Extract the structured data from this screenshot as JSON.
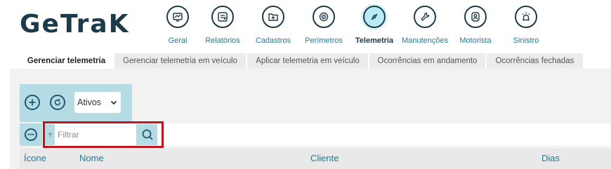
{
  "logo": {
    "text": "GeTraK"
  },
  "nav": [
    {
      "label": "Geral",
      "icon": "chart-monitor-icon",
      "active": false
    },
    {
      "label": "Relatórios",
      "icon": "report-icon",
      "active": false
    },
    {
      "label": "Cadastros",
      "icon": "folder-plus-icon",
      "active": false
    },
    {
      "label": "Perímetros",
      "icon": "geofence-icon",
      "active": false
    },
    {
      "label": "Telemetria",
      "icon": "compass-icon",
      "active": true
    },
    {
      "label": "Manutenções",
      "icon": "wrench-icon",
      "active": false
    },
    {
      "label": "Motorista",
      "icon": "driver-icon",
      "active": false
    },
    {
      "label": "Sinistro",
      "icon": "alarm-icon",
      "active": false
    }
  ],
  "tabs": [
    {
      "label": "Gerenciar telemetria",
      "active": true
    },
    {
      "label": "Gerenciar telemetria em veículo",
      "active": false
    },
    {
      "label": "Aplicar telemetria em veículo",
      "active": false
    },
    {
      "label": "Ocorrências em andamento",
      "active": false
    },
    {
      "label": "Ocorrências fechadas",
      "active": false
    }
  ],
  "toolbar": {
    "add_icon": "plus-circle-icon",
    "refresh_icon": "refresh-icon",
    "status_select": {
      "value": "Ativos"
    }
  },
  "filter": {
    "placeholder": "Filtrar",
    "value": ""
  },
  "table": {
    "columns": [
      "Ícone",
      "Nome",
      "Cliente",
      "Dias"
    ]
  },
  "colors": {
    "brand": "#1d3a4a",
    "accent": "#1e7b94",
    "toolbar_bg": "#b5dbe4",
    "active_nav_bg": "#b9ecf2",
    "highlight_border": "#c0151e"
  }
}
